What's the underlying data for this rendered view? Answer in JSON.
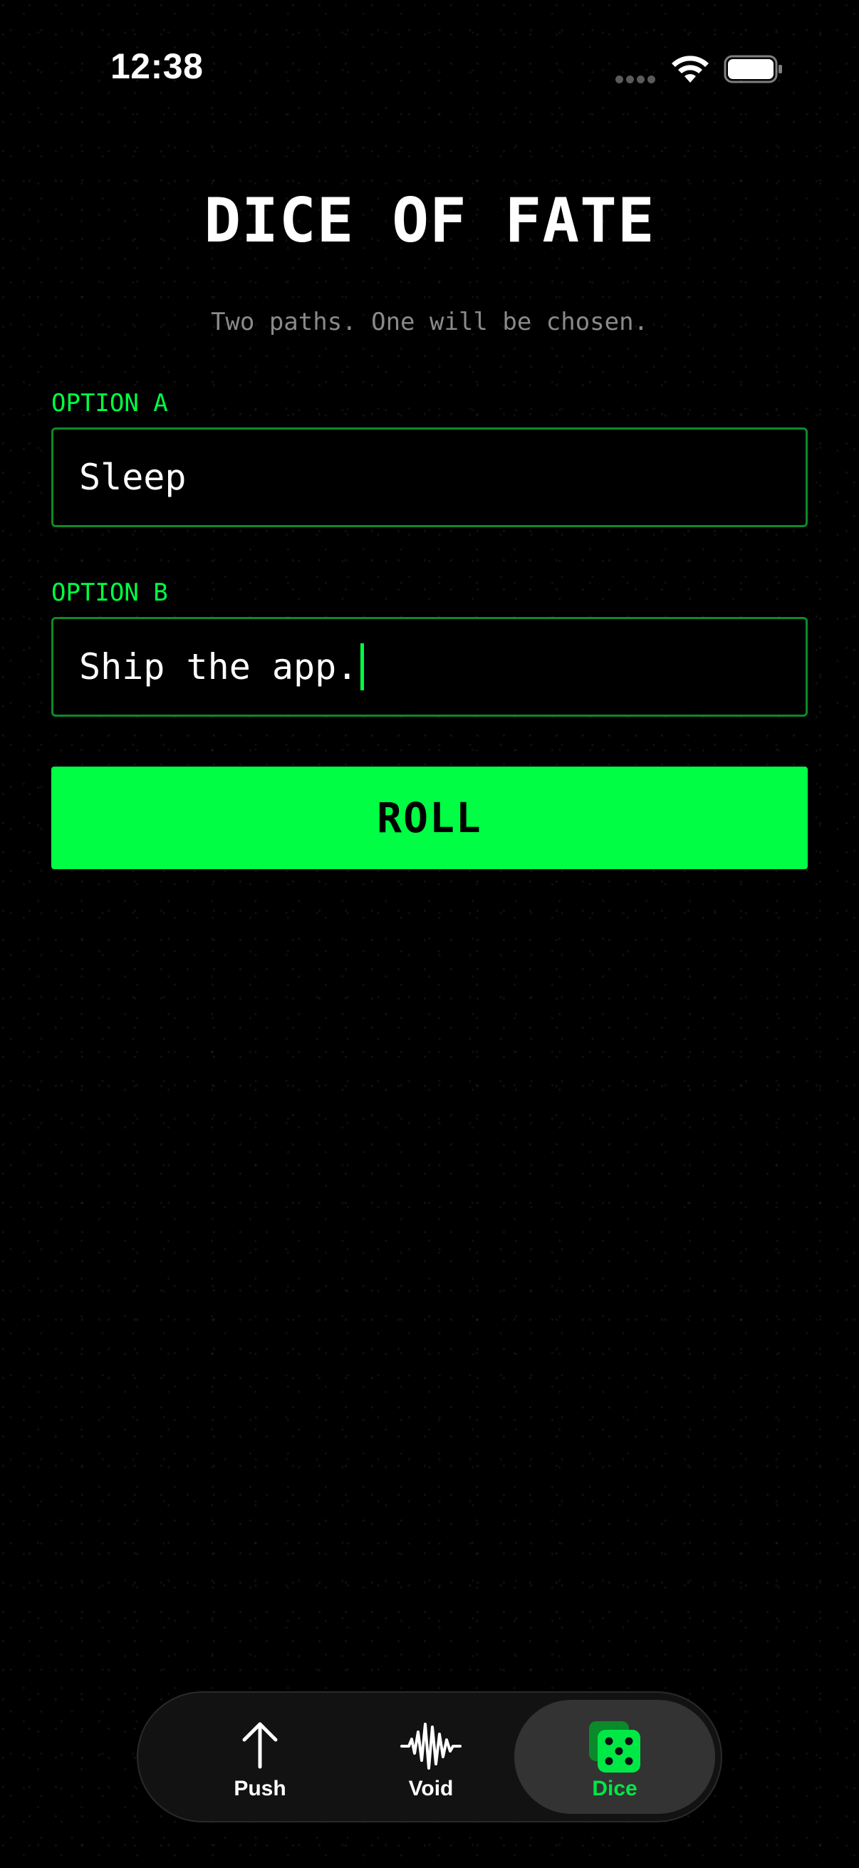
{
  "status_bar": {
    "time": "12:38"
  },
  "header": {
    "title": "DICE OF FATE",
    "subtitle": "Two paths. One will be chosen."
  },
  "form": {
    "option_a": {
      "label": "OPTION A",
      "value": "Sleep"
    },
    "option_b": {
      "label": "OPTION B",
      "value": "Ship the app."
    },
    "roll_label": "ROLL"
  },
  "tab_bar": {
    "tabs": [
      {
        "label": "Push",
        "icon": "arrow-up-icon",
        "active": false
      },
      {
        "label": "Void",
        "icon": "waveform-icon",
        "active": false
      },
      {
        "label": "Dice",
        "icon": "dice-icon",
        "active": true
      }
    ]
  },
  "colors": {
    "accent": "#00ff44",
    "background": "#000000",
    "field_border": "#0d8a2a",
    "subtitle": "#8a8a8a"
  }
}
